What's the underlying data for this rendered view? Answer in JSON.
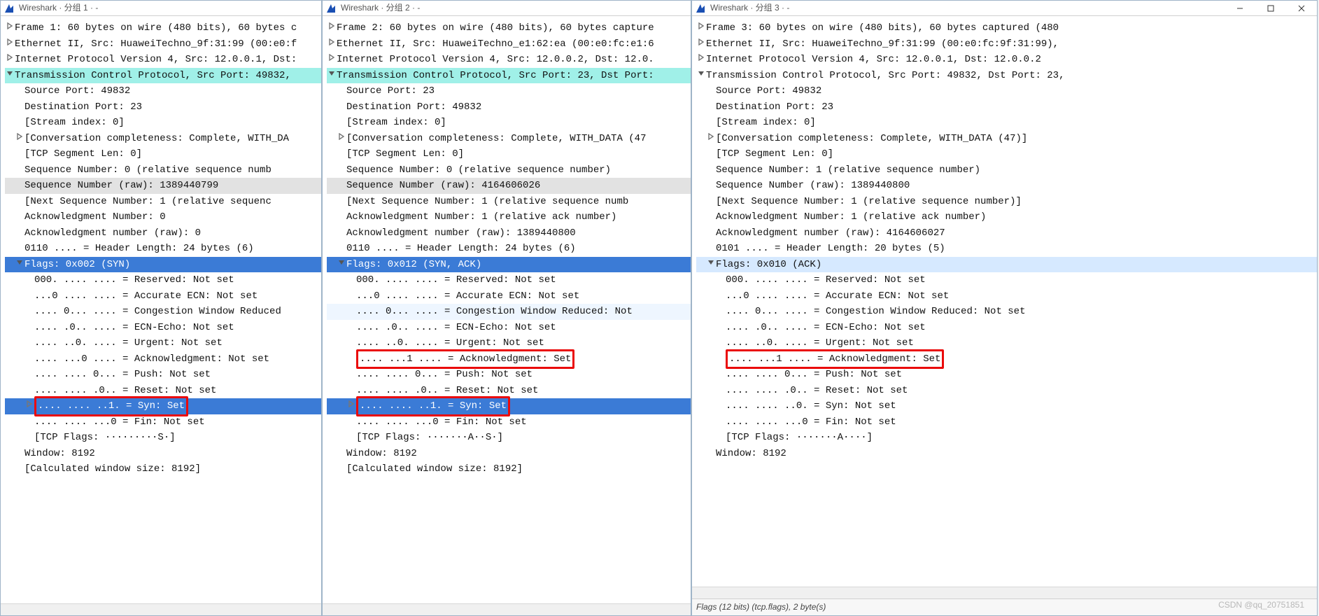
{
  "watermark": "CSDN @qq_20751851",
  "windows": [
    {
      "title": "Wireshark · 分组 1 · -",
      "has_controls": false,
      "statusbar": null,
      "rows": [
        {
          "caret": "right",
          "ind": 0,
          "cls": "",
          "text": "Frame 1: 60 bytes on wire (480 bits), 60 bytes c"
        },
        {
          "caret": "right",
          "ind": 0,
          "cls": "",
          "text": "Ethernet II, Src: HuaweiTechno_9f:31:99 (00:e0:f"
        },
        {
          "caret": "right",
          "ind": 0,
          "cls": "",
          "text": "Internet Protocol Version 4, Src: 12.0.0.1, Dst:"
        },
        {
          "caret": "down",
          "ind": 0,
          "cls": "hl-tcp",
          "text": "Transmission Control Protocol, Src Port: 49832,"
        },
        {
          "caret": "",
          "ind": 1,
          "cls": "",
          "text": "Source Port: 49832"
        },
        {
          "caret": "",
          "ind": 1,
          "cls": "",
          "text": "Destination Port: 23"
        },
        {
          "caret": "",
          "ind": 1,
          "cls": "",
          "text": "[Stream index: 0]"
        },
        {
          "caret": "right",
          "ind": 1,
          "cls": "",
          "text": "[Conversation completeness: Complete, WITH_DA"
        },
        {
          "caret": "",
          "ind": 1,
          "cls": "",
          "text": "[TCP Segment Len: 0]"
        },
        {
          "caret": "",
          "ind": 1,
          "cls": "",
          "text": "Sequence Number: 0    (relative sequence numb"
        },
        {
          "caret": "",
          "ind": 1,
          "cls": "hl-grey",
          "text": "Sequence Number (raw): 1389440799"
        },
        {
          "caret": "",
          "ind": 1,
          "cls": "",
          "text": "[Next Sequence Number: 1    (relative sequenc"
        },
        {
          "caret": "",
          "ind": 1,
          "cls": "",
          "text": "Acknowledgment Number: 0"
        },
        {
          "caret": "",
          "ind": 1,
          "cls": "",
          "text": "Acknowledgment number (raw): 0"
        },
        {
          "caret": "",
          "ind": 1,
          "cls": "",
          "text": "0110 .... = Header Length: 24 bytes (6)"
        },
        {
          "caret": "down",
          "ind": 1,
          "cls": "hl-sel",
          "text": "Flags: 0x002 (SYN)"
        },
        {
          "caret": "",
          "ind": 2,
          "cls": "",
          "text": "000. .... .... = Reserved: Not set"
        },
        {
          "caret": "",
          "ind": 2,
          "cls": "",
          "text": "...0 .... .... = Accurate ECN: Not set"
        },
        {
          "caret": "",
          "ind": 2,
          "cls": "",
          "text": ".... 0... .... = Congestion Window Reduced"
        },
        {
          "caret": "",
          "ind": 2,
          "cls": "",
          "text": ".... .0.. .... = ECN-Echo: Not set"
        },
        {
          "caret": "",
          "ind": 2,
          "cls": "",
          "text": ".... ..0. .... = Urgent: Not set"
        },
        {
          "caret": "",
          "ind": 2,
          "cls": "",
          "text": ".... ...0 .... = Acknowledgment: Not set"
        },
        {
          "caret": "",
          "ind": 2,
          "cls": "",
          "text": ".... .... 0... = Push: Not set"
        },
        {
          "caret": "",
          "ind": 2,
          "cls": "",
          "text": ".... .... .0.. = Reset: Not set"
        },
        {
          "caret": "right",
          "ind": 2,
          "cls": "hl-sel",
          "text": ".... .... ..1. = Syn: Set",
          "red": true
        },
        {
          "caret": "",
          "ind": 2,
          "cls": "",
          "text": ".... .... ...0 = Fin: Not set"
        },
        {
          "caret": "",
          "ind": 2,
          "cls": "",
          "text": "[TCP Flags: ·········S·]"
        },
        {
          "caret": "",
          "ind": 1,
          "cls": "",
          "text": "Window: 8192"
        },
        {
          "caret": "",
          "ind": 1,
          "cls": "",
          "text": "[Calculated window size: 8192]"
        }
      ]
    },
    {
      "title": "Wireshark · 分组 2 · -",
      "has_controls": false,
      "statusbar": null,
      "rows": [
        {
          "caret": "right",
          "ind": 0,
          "cls": "",
          "text": "Frame 2: 60 bytes on wire (480 bits), 60 bytes capture"
        },
        {
          "caret": "right",
          "ind": 0,
          "cls": "",
          "text": "Ethernet II, Src: HuaweiTechno_e1:62:ea (00:e0:fc:e1:6"
        },
        {
          "caret": "right",
          "ind": 0,
          "cls": "",
          "text": "Internet Protocol Version 4, Src: 12.0.0.2, Dst: 12.0."
        },
        {
          "caret": "down",
          "ind": 0,
          "cls": "hl-tcp",
          "text": "Transmission Control Protocol, Src Port: 23, Dst Port:"
        },
        {
          "caret": "",
          "ind": 1,
          "cls": "",
          "text": "Source Port: 23"
        },
        {
          "caret": "",
          "ind": 1,
          "cls": "",
          "text": "Destination Port: 49832"
        },
        {
          "caret": "",
          "ind": 1,
          "cls": "",
          "text": "[Stream index: 0]"
        },
        {
          "caret": "right",
          "ind": 1,
          "cls": "",
          "text": "[Conversation completeness: Complete, WITH_DATA (47"
        },
        {
          "caret": "",
          "ind": 1,
          "cls": "",
          "text": "[TCP Segment Len: 0]"
        },
        {
          "caret": "",
          "ind": 1,
          "cls": "",
          "text": "Sequence Number: 0    (relative sequence number)"
        },
        {
          "caret": "",
          "ind": 1,
          "cls": "hl-grey",
          "text": "Sequence Number (raw): 4164606026"
        },
        {
          "caret": "",
          "ind": 1,
          "cls": "",
          "text": "[Next Sequence Number: 1    (relative sequence numb"
        },
        {
          "caret": "",
          "ind": 1,
          "cls": "",
          "text": "Acknowledgment Number: 1    (relative ack number)"
        },
        {
          "caret": "",
          "ind": 1,
          "cls": "",
          "text": "Acknowledgment number (raw): 1389440800"
        },
        {
          "caret": "",
          "ind": 1,
          "cls": "",
          "text": "0110 .... = Header Length: 24 bytes (6)"
        },
        {
          "caret": "down",
          "ind": 1,
          "cls": "hl-sel",
          "text": "Flags: 0x012 (SYN, ACK)"
        },
        {
          "caret": "",
          "ind": 2,
          "cls": "",
          "text": "000. .... .... = Reserved: Not set"
        },
        {
          "caret": "",
          "ind": 2,
          "cls": "",
          "text": "...0 .... .... = Accurate ECN: Not set"
        },
        {
          "caret": "",
          "ind": 2,
          "cls": "hl-faint",
          "text": ".... 0... .... = Congestion Window Reduced: Not"
        },
        {
          "caret": "",
          "ind": 2,
          "cls": "",
          "text": ".... .0.. .... = ECN-Echo: Not set"
        },
        {
          "caret": "",
          "ind": 2,
          "cls": "",
          "text": ".... ..0. .... = Urgent: Not set"
        },
        {
          "caret": "",
          "ind": 2,
          "cls": "",
          "text": ".... ...1 .... = Acknowledgment: Set",
          "red": true
        },
        {
          "caret": "",
          "ind": 2,
          "cls": "",
          "text": ".... .... 0... = Push: Not set"
        },
        {
          "caret": "",
          "ind": 2,
          "cls": "",
          "text": ".... .... .0.. = Reset: Not set"
        },
        {
          "caret": "right",
          "ind": 2,
          "cls": "hl-sel",
          "text": ".... .... ..1. = Syn: Set",
          "red": true
        },
        {
          "caret": "",
          "ind": 2,
          "cls": "",
          "text": ".... .... ...0 = Fin: Not set"
        },
        {
          "caret": "",
          "ind": 2,
          "cls": "",
          "text": "[TCP Flags: ·······A··S·]"
        },
        {
          "caret": "",
          "ind": 1,
          "cls": "",
          "text": "Window: 8192"
        },
        {
          "caret": "",
          "ind": 1,
          "cls": "",
          "text": "[Calculated window size: 8192]"
        }
      ]
    },
    {
      "title": "Wireshark · 分组 3 · -",
      "has_controls": true,
      "statusbar": "Flags (12 bits) (tcp.flags), 2 byte(s)",
      "rows": [
        {
          "caret": "right",
          "ind": 0,
          "cls": "",
          "text": "Frame 3: 60 bytes on wire (480 bits), 60 bytes captured (480"
        },
        {
          "caret": "right",
          "ind": 0,
          "cls": "",
          "text": "Ethernet II, Src: HuaweiTechno_9f:31:99 (00:e0:fc:9f:31:99),"
        },
        {
          "caret": "right",
          "ind": 0,
          "cls": "",
          "text": "Internet Protocol Version 4, Src: 12.0.0.1, Dst: 12.0.0.2"
        },
        {
          "caret": "down",
          "ind": 0,
          "cls": "",
          "text": "Transmission Control Protocol, Src Port: 49832, Dst Port: 23,"
        },
        {
          "caret": "",
          "ind": 1,
          "cls": "",
          "text": "Source Port: 49832"
        },
        {
          "caret": "",
          "ind": 1,
          "cls": "",
          "text": "Destination Port: 23"
        },
        {
          "caret": "",
          "ind": 1,
          "cls": "",
          "text": "[Stream index: 0]"
        },
        {
          "caret": "right",
          "ind": 1,
          "cls": "",
          "text": "[Conversation completeness: Complete, WITH_DATA (47)]"
        },
        {
          "caret": "",
          "ind": 1,
          "cls": "",
          "text": "[TCP Segment Len: 0]"
        },
        {
          "caret": "",
          "ind": 1,
          "cls": "",
          "text": "Sequence Number: 1    (relative sequence number)"
        },
        {
          "caret": "",
          "ind": 1,
          "cls": "",
          "text": "Sequence Number (raw): 1389440800"
        },
        {
          "caret": "",
          "ind": 1,
          "cls": "",
          "text": "[Next Sequence Number: 1    (relative sequence number)]"
        },
        {
          "caret": "",
          "ind": 1,
          "cls": "",
          "text": "Acknowledgment Number: 1    (relative ack number)"
        },
        {
          "caret": "",
          "ind": 1,
          "cls": "",
          "text": "Acknowledgment number (raw): 4164606027"
        },
        {
          "caret": "",
          "ind": 1,
          "cls": "",
          "text": "0101 .... = Header Length: 20 bytes (5)"
        },
        {
          "caret": "down",
          "ind": 1,
          "cls": "hl-sel-light",
          "text": "Flags: 0x010 (ACK)"
        },
        {
          "caret": "",
          "ind": 2,
          "cls": "",
          "text": "000. .... .... = Reserved: Not set"
        },
        {
          "caret": "",
          "ind": 2,
          "cls": "",
          "text": "...0 .... .... = Accurate ECN: Not set"
        },
        {
          "caret": "",
          "ind": 2,
          "cls": "",
          "text": ".... 0... .... = Congestion Window Reduced: Not set"
        },
        {
          "caret": "",
          "ind": 2,
          "cls": "",
          "text": ".... .0.. .... = ECN-Echo: Not set"
        },
        {
          "caret": "",
          "ind": 2,
          "cls": "",
          "text": ".... ..0. .... = Urgent: Not set"
        },
        {
          "caret": "",
          "ind": 2,
          "cls": "",
          "text": ".... ...1 .... = Acknowledgment: Set",
          "red": true
        },
        {
          "caret": "",
          "ind": 2,
          "cls": "",
          "text": ".... .... 0... = Push: Not set"
        },
        {
          "caret": "",
          "ind": 2,
          "cls": "",
          "text": ".... .... .0.. = Reset: Not set"
        },
        {
          "caret": "",
          "ind": 2,
          "cls": "",
          "text": ".... .... ..0. = Syn: Not set"
        },
        {
          "caret": "",
          "ind": 2,
          "cls": "",
          "text": ".... .... ...0 = Fin: Not set"
        },
        {
          "caret": "",
          "ind": 2,
          "cls": "",
          "text": "[TCP Flags: ·······A····]"
        },
        {
          "caret": "",
          "ind": 1,
          "cls": "",
          "text": "Window: 8192"
        }
      ]
    }
  ]
}
